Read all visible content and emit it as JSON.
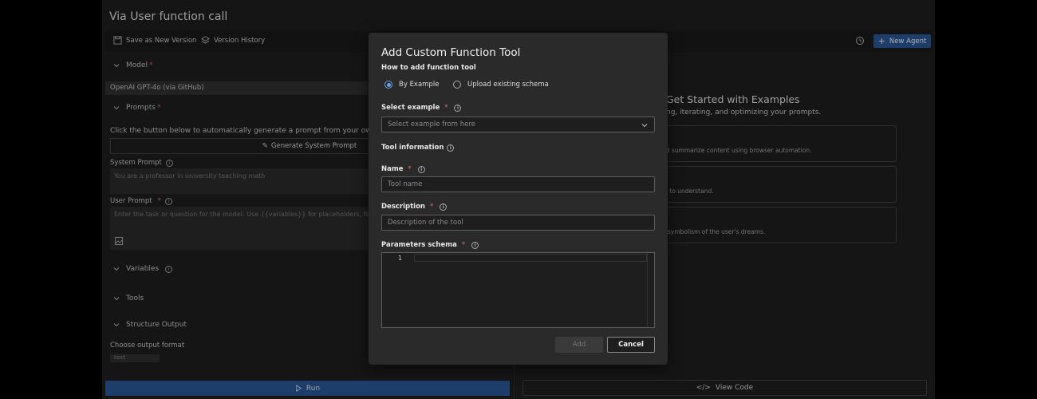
{
  "app": {
    "title": "Via User function call"
  },
  "toolbar": {
    "save_label": "Save as New Version",
    "history_label": "Version History",
    "new_agent_label": "New Agent"
  },
  "left": {
    "model_label": "Model",
    "model_value": "OpenAI GPT-4o (via GitHub)",
    "prompts_label": "Prompts",
    "generate_hint": "Click the button below to automatically generate a prompt from your own description",
    "generate_label": "Generate System Prompt",
    "system_prompt_label": "System Prompt",
    "system_prompt_value": "You are a professor in university teaching math",
    "user_prompt_label": "User Prompt",
    "user_prompt_placeholder": "Enter the task or question for the model. Use {{variables}} for placeholders, for example: \"Tell me a joke about {{topic}}\"",
    "variables_label": "Variables",
    "tools_label": "Tools",
    "structure_label": "Structure Output",
    "format_label": "Choose output format",
    "format_value": "text",
    "run_label": "Run"
  },
  "right": {
    "heading": "Get Started with Examples",
    "subheading": "ng, iterating, and optimizing your prompts.",
    "examples": [
      {
        "text": "nd summarize content using browser automation."
      },
      {
        "text": "rs to understand."
      },
      {
        "text": "e symbolism of the user's dreams."
      }
    ],
    "view_code_label": "View Code"
  },
  "modal": {
    "title": "Add Custom Function Tool",
    "how_label": "How to add function tool",
    "radio_example": "By Example",
    "radio_upload": "Upload existing schema",
    "selected_radio": "By Example",
    "select_example_label": "Select example",
    "select_example_placeholder": "Select example from here",
    "tool_info_label": "Tool information",
    "name_label": "Name",
    "name_placeholder": "Tool name",
    "description_label": "Description",
    "description_placeholder": "Description of the tool",
    "params_label": "Parameters schema",
    "line_number": "1",
    "add_label": "Add",
    "cancel_label": "Cancel"
  },
  "colors": {
    "accent": "#2b5a9e",
    "required": "#e26c6c",
    "radio_selected": "#6aa0e8"
  },
  "icons": [
    "save-icon",
    "layers-icon",
    "history-icon",
    "plus-icon",
    "chevron-down-icon",
    "info-icon",
    "sparkle-icon",
    "image-icon",
    "play-icon",
    "code-icon"
  ]
}
